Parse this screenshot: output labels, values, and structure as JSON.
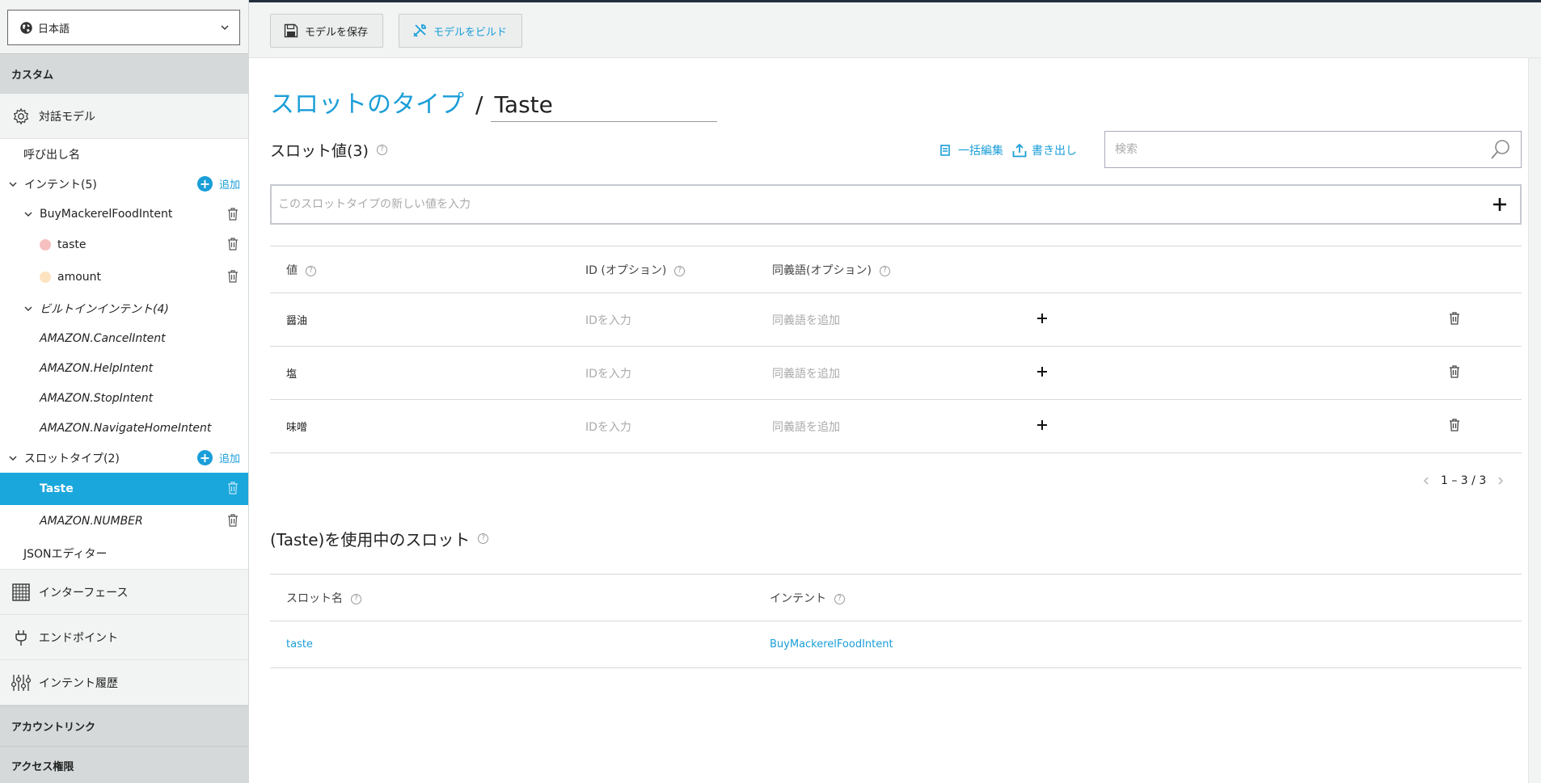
{
  "language": {
    "selected": "日本語"
  },
  "sidebar": {
    "section_custom": "カスタム",
    "interaction_model": "対話モデル",
    "invocation_name": "呼び出し名",
    "intents": {
      "label": "インテント(5)",
      "add": "追加",
      "custom_intent": "BuyMackerelFoodIntent",
      "slots": [
        {
          "label": "taste",
          "color": "#f6c0c0"
        },
        {
          "label": "amount",
          "color": "#fde3c0"
        }
      ],
      "builtin_label": "ビルトインインテント(4)",
      "builtin_items": [
        "AMAZON.CancelIntent",
        "AMAZON.HelpIntent",
        "AMAZON.StopIntent",
        "AMAZON.NavigateHomeIntent"
      ]
    },
    "slot_types": {
      "label": "スロットタイプ(2)",
      "add": "追加",
      "items": [
        "Taste",
        "AMAZON.NUMBER"
      ]
    },
    "json_editor": "JSONエディター",
    "interfaces": "インターフェース",
    "endpoint": "エンドポイント",
    "intent_history": "インテント履歴",
    "section_account_linking": "アカウントリンク",
    "section_permissions": "アクセス権限"
  },
  "toolbar": {
    "save_label": "モデルを保存",
    "build_label": "モデルをビルド"
  },
  "main": {
    "breadcrumb_link": "スロットのタイプ",
    "breadcrumb_sep": "/",
    "slot_type_name": "Taste",
    "values_heading": "スロット値(3)",
    "bulk_edit": "一括編集",
    "export": "書き出し",
    "search_placeholder": "検索",
    "new_value_placeholder": "このスロットタイプの新しい値を入力",
    "columns": [
      "値",
      "ID (オプション)",
      "同義語(オプション)"
    ],
    "id_placeholder": "IDを入力",
    "synonym_placeholder": "同義語を追加",
    "rows": [
      "醤油",
      "塩",
      "味噌"
    ],
    "pagination": "1 – 3 / 3",
    "used_heading": "(Taste)を使用中のスロット",
    "used_columns": [
      "スロット名",
      "インテント"
    ],
    "used_rows": [
      {
        "slot": "taste",
        "intent": "BuyMackerelFoodIntent"
      }
    ]
  },
  "colors": {
    "accent": "#1a9ed8",
    "selected_bg": "#1aa7dc",
    "header_bg": "#d5d9d9",
    "topbar_border": "#232f3e"
  }
}
